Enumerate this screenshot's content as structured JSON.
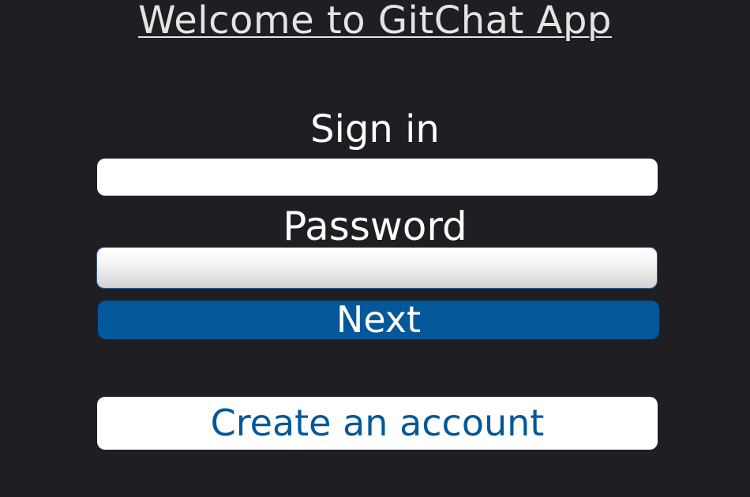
{
  "header": {
    "title": "Welcome to GitChat App"
  },
  "login_form": {
    "signin_label": "Sign in",
    "username_value": "",
    "password_label": "Password",
    "password_value": "",
    "next_label": "Next",
    "create_account_label": "Create an account"
  },
  "colors": {
    "background": "#1f1e23",
    "primary": "#02589b",
    "field": "#ffffff",
    "text": "#ffffff"
  }
}
